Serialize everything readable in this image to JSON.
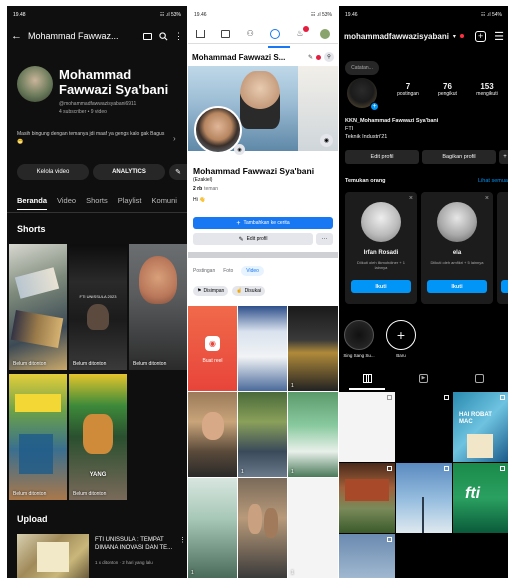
{
  "youtube": {
    "status_time": "19.48",
    "status_right": "☷ .ıl 53%",
    "topbar_title": "Mohammad Fawwaz...",
    "channel_name": "Mohammad Fawwazi Sya'bani",
    "handle": "@mohammadfawwazisyabani6911",
    "subs": "4 subscriber • 9 video",
    "about": "Masih bingung dengan temanya jdi maaf ya gengs kalo gak Bagus 😁",
    "manage_label": "Kelola video",
    "analytics_label": "ANALYTICS",
    "tabs": [
      "Beranda",
      "Video",
      "Shorts",
      "Playlist",
      "Komuni"
    ],
    "shorts_heading": "Shorts",
    "shorts": [
      {
        "label": "Belum ditonton"
      },
      {
        "label": "Belum ditonton"
      },
      {
        "label": "Belum ditonton"
      },
      {
        "label": "Belum ditonton"
      },
      {
        "label": "Belum ditonton"
      }
    ],
    "short_overlay_1": "FTI UNISSULA 2023",
    "short_overlay_4": "YANG",
    "upload_heading": "Upload",
    "upload_title": "FTI UNISSULA : TEMPAT DIMANA INOVASI DAN TE...",
    "upload_meta": "1 x ditonton · 2 hari yang lalu"
  },
  "facebook": {
    "status_time": "19.46",
    "status_right": "☷ .ıl 53%",
    "page_title": "Mohammad Fawwazi S...",
    "name": "Mohammad Fawwazi Sya'bani",
    "nickname": "(Ezakiel)",
    "friends_count": "2 rb",
    "friends_label": "teman",
    "bio": "Hi 👋",
    "add_story_label": "Tambahkan ke cerita",
    "edit_profile_label": "Edit profil",
    "more_label": "···",
    "tabs": [
      "Postingan",
      "Foto",
      "Video"
    ],
    "saved_label": "Disimpan",
    "liked_label": "Disukai",
    "create_reel_label": "Buat reel",
    "video_counts": [
      "",
      "",
      "1",
      "",
      "1",
      "1",
      "1",
      "",
      "1"
    ]
  },
  "instagram": {
    "status_time": "19.46",
    "status_right": "☷ .ıl 54%",
    "username": "mohammadfawwazisyabani",
    "note_placeholder": "Catatan...",
    "stats": [
      {
        "value": "7",
        "label": "postingan"
      },
      {
        "value": "76",
        "label": "pengikut"
      },
      {
        "value": "153",
        "label": "mengikuti"
      }
    ],
    "display_name": "KKN_Mohammad Fawwazi Sya'bani",
    "bio_line1": "FTI",
    "bio_line2": "Teknik Industri'21",
    "edit_profile_label": "Edit profil",
    "share_profile_label": "Bagikan profil",
    "discover_title": "Temukan orang",
    "see_all_label": "Lihat semua",
    "suggestions": [
      {
        "name": "Irfan Rosadi",
        "sub": "Diikuti oleh ilkmohdiner + 1 lainnya",
        "follow": "Ikuti"
      },
      {
        "name": "ela",
        "sub": "Diikuti oleh amfikri + 5 lainnya",
        "follow": "Ikuti"
      }
    ],
    "highlights": [
      {
        "label": "Sing Sang Su..."
      },
      {
        "label": "Baru"
      }
    ],
    "post_overlay_fti": "fti",
    "post_overlay_mac": "HAI ROBAT MAC"
  },
  "colors": {
    "fb_blue": "#1877f2",
    "ig_blue": "#0095f6",
    "yt_dark": "#0f0f0f",
    "ig_card": "#1c1c1c"
  }
}
